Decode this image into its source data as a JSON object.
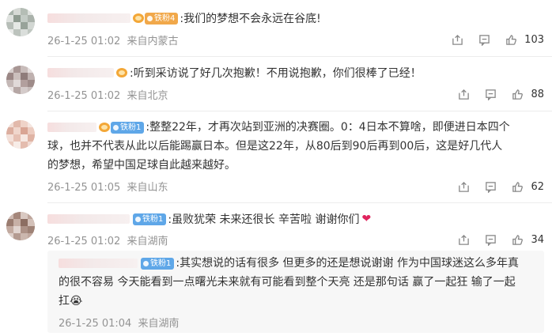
{
  "comments": [
    {
      "badge": "铁粉4",
      "text": ":我们的梦想不会永远在谷底!",
      "date": "26-1-25 01:02",
      "location": "来自内蒙古",
      "likes": "103"
    },
    {
      "badge": "",
      "text": ":听到采访说了好几次抱歉！不用说抱歉，你们很棒了已经！",
      "date": "26-1-25 01:02",
      "location": "来自北京",
      "likes": "88"
    },
    {
      "badge": "铁粉1",
      "text_lines": [
        ":整整22年，才再次站到亚洲的决赛圈。0：4日本不算啥，即便进日本四个",
        "球，也并不代表从此以后能踢赢日本。但是这22年，从80后到90后再到00后，这是好几代人",
        "的梦想，希望中国足球自此越来越好。"
      ],
      "date": "26-1-25 01:05",
      "location": "来自山东",
      "likes": "62"
    },
    {
      "badge": "铁粉1",
      "text": ":虽败犹荣 未来还很长 辛苦啦 谢谢你们",
      "emoji": "❤",
      "date": "26-1-25 01:02",
      "location": "来自湖南",
      "likes": "34"
    }
  ],
  "reply": {
    "badge": "铁粉1",
    "text_lines": [
      ":其实想说的话有很多 但更多的还是想说谢谢 作为中国球迷这么多年真",
      "的很不容易 今天能看到一点曙光未来就有可能看到整个天亮 还是那句话 赢了一起狂 输了一起",
      "扛😭"
    ],
    "date": "26-1-25 01:04",
    "location": "来自湖南"
  },
  "colors": {
    "meta": "#939393",
    "heart": "#e0245e",
    "fan_badge": "#5fa7e8"
  }
}
